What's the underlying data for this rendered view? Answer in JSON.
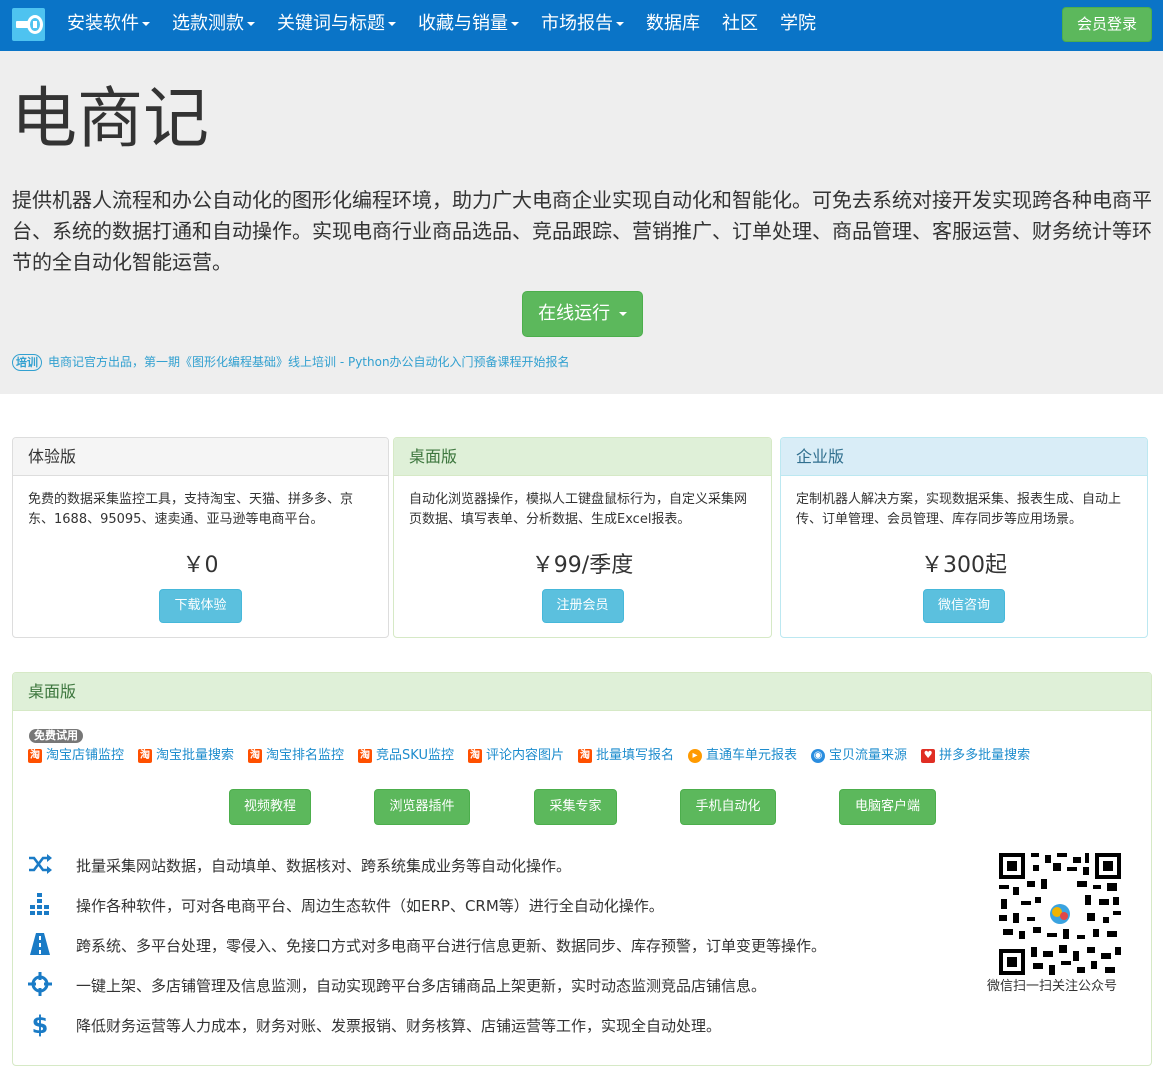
{
  "navbar": {
    "logo_icon": "key-logo-icon",
    "items": [
      {
        "label": "安装软件",
        "dropdown": true
      },
      {
        "label": "选款测款",
        "dropdown": true
      },
      {
        "label": "关键词与标题",
        "dropdown": true
      },
      {
        "label": "收藏与销量",
        "dropdown": true
      },
      {
        "label": "市场报告",
        "dropdown": true
      },
      {
        "label": "数据库",
        "dropdown": false
      },
      {
        "label": "社区",
        "dropdown": false
      },
      {
        "label": "学院",
        "dropdown": false
      }
    ],
    "login_label": "会员登录"
  },
  "hero": {
    "title": "电商记",
    "description": "提供机器人流程和办公自动化的图形化编程环境，助力广大电商企业实现自动化和智能化。可免去系统对接开发实现跨各种电商平台、系统的数据打通和自动操作。实现电商行业商品选品、竞品跟踪、营销推广、订单处理、商品管理、客服运营、财务统计等环节的全自动化智能运营。",
    "run_button": "在线运行",
    "notice_tag": "培训",
    "notice_text": "电商记官方出品，第一期《图形化编程基础》线上培训 - Python办公自动化入门预备课程开始报名"
  },
  "plans": [
    {
      "name": "体验版",
      "description": "免费的数据采集监控工具，支持淘宝、天猫、拼多多、京东、1688、95095、速卖通、亚马逊等电商平台。",
      "price": "￥0",
      "button": "下载体验"
    },
    {
      "name": "桌面版",
      "description": "自动化浏览器操作，模拟人工键盘鼠标行为，自定义采集网页数据、填写表单、分析数据、生成Excel报表。",
      "price": "￥99/季度",
      "button": "注册会员"
    },
    {
      "name": "企业版",
      "description": "定制机器人解决方案，实现数据采集、报表生成、自动上传、订单管理、会员管理、库存同步等应用场景。",
      "price": "￥300起",
      "button": "微信咨询"
    }
  ],
  "desktop": {
    "heading": "桌面版",
    "badge": "免费试用",
    "tools": [
      {
        "label": "淘宝店铺监控",
        "icon": "taobao-icon"
      },
      {
        "label": "淘宝批量搜索",
        "icon": "taobao-icon"
      },
      {
        "label": "淘宝排名监控",
        "icon": "taobao-icon"
      },
      {
        "label": "竞品SKU监控",
        "icon": "taobao-icon"
      },
      {
        "label": "评论内容图片",
        "icon": "taobao-icon"
      },
      {
        "label": "批量填写报名",
        "icon": "taobao-icon"
      },
      {
        "label": "直通车单元报表",
        "icon": "train-icon"
      },
      {
        "label": "宝贝流量来源",
        "icon": "flow-icon"
      },
      {
        "label": "拼多多批量搜索",
        "icon": "pinduoduo-icon"
      }
    ],
    "buttons": [
      "视频教程",
      "浏览器插件",
      "采集专家",
      "手机自动化",
      "电脑客户端"
    ],
    "features": [
      {
        "icon": "shuffle-icon",
        "text": "批量采集网站数据，自动填单、数据核对、跨系统集成业务等自动化操作。"
      },
      {
        "icon": "tasks-icon",
        "text": "操作各种软件，可对各电商平台、周边生态软件（如ERP、CRM等）进行全自动化操作。"
      },
      {
        "icon": "road-icon",
        "text": "跨系统、多平台处理，零侵入、免接口方式对多电商平台进行信息更新、数据同步、库存预警，订单变更等操作。"
      },
      {
        "icon": "crosshairs-icon",
        "text": "一键上架、多店铺管理及信息监测，自动实现跨平台多店铺商品上架更新，实时动态监测竞品店铺信息。"
      },
      {
        "icon": "dollar-icon",
        "text": "降低财务运营等人力成本，财务对账、发票报销、财务核算、店铺运营等工作，实现全自动处理。"
      }
    ],
    "qr_caption": "微信扫一扫关注公众号"
  }
}
